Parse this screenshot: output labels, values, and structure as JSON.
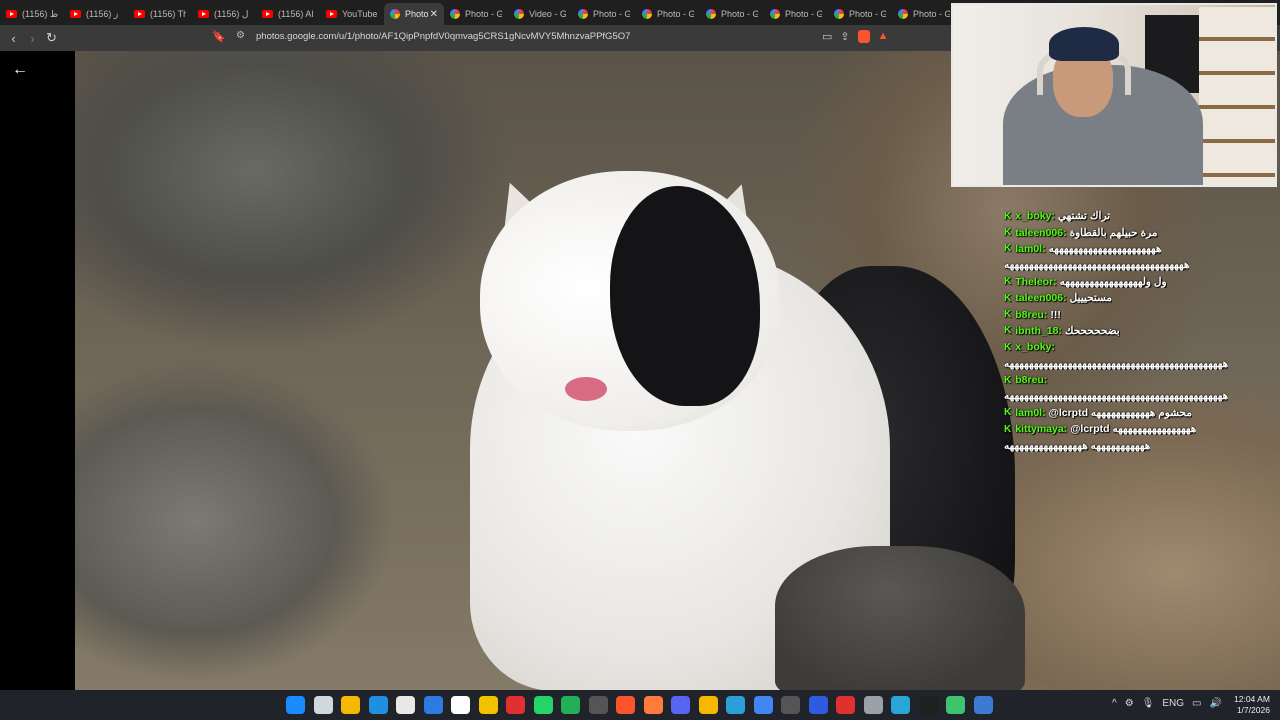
{
  "browser": {
    "tabs": [
      {
        "label": "(1156) ظ",
        "favicon": "youtube-icon"
      },
      {
        "label": "(1156) ز",
        "favicon": "youtube-icon"
      },
      {
        "label": "(1156) Th",
        "favicon": "youtube-icon"
      },
      {
        "label": "(1156) ل",
        "favicon": "youtube-icon"
      },
      {
        "label": "(1156) Al",
        "favicon": "youtube-icon"
      },
      {
        "label": "YouTube",
        "favicon": "youtube-icon"
      },
      {
        "label": "Photo",
        "favicon": "google-photos-icon",
        "active": true
      },
      {
        "label": "Photo - G",
        "favicon": "google-photos-icon"
      },
      {
        "label": "Video - G",
        "favicon": "google-photos-icon"
      },
      {
        "label": "Photo - G",
        "favicon": "google-photos-icon"
      },
      {
        "label": "Photo - G",
        "favicon": "google-photos-icon"
      },
      {
        "label": "Photo - G",
        "favicon": "google-photos-icon"
      },
      {
        "label": "Photo - G",
        "favicon": "google-photos-icon"
      },
      {
        "label": "Photo - G",
        "favicon": "google-photos-icon"
      },
      {
        "label": "Photo - G",
        "favicon": "google-photos-icon"
      }
    ],
    "close_glyph": "✕",
    "url": "photos.google.com/u/1/photo/AF1QipPnpfdV0qmvag5CRS1gNcvMVY5MhnzvaPPfG5O7",
    "brave_badge": "2"
  },
  "chat": {
    "messages": [
      {
        "user": "x_boky:",
        "text": "تراك تشتهي"
      },
      {
        "user": "taleen006:",
        "text": "مرة حبيلهم بالقطاوة"
      },
      {
        "user": "lam0l:",
        "text": "ههههههههههههههههههههههه"
      },
      {
        "user": "",
        "text": "هههههههههههههههههههههههههههههههههههههه"
      },
      {
        "user": "Theleor:",
        "text": "ول ولههههههههههههههههه"
      },
      {
        "user": "taleen006:",
        "text": "مستحيييل"
      },
      {
        "user": "b8reu:",
        "text": "!!!"
      },
      {
        "user": "ibnth_18:",
        "text": "بضحححححك"
      },
      {
        "user": "x_boky:",
        "text": ""
      },
      {
        "user": "",
        "text": "هههههههههههههههههههههههههههههههههههههههههههههه"
      },
      {
        "user": "b8reu:",
        "text": ""
      },
      {
        "user": "",
        "text": "هههههههههههههههههههههههههههههههههههههههههههههه"
      },
      {
        "user": "lam0l:",
        "text": "@lcrptd محشوم ههههههههههههه"
      },
      {
        "user": "kittymaya:",
        "text": "@lcrptd ههههههههههههههههه"
      },
      {
        "user": "",
        "text": "هههههههههههه ههههههههههههههههه"
      }
    ],
    "kick_glyph": "K"
  },
  "taskbar": {
    "icon_colors": [
      "#1a8cff",
      "#cfd8dc",
      "#f5b700",
      "#1f8fe0",
      "#e8e8e8",
      "#2d7be0",
      "#ffffff",
      "#f2c200",
      "#e03030",
      "#25d366",
      "#21b058",
      "#555555",
      "#fb542b",
      "#ff7a3d",
      "#5865f2",
      "#f5b700",
      "#2b9fd8",
      "#4285f4",
      "#555555",
      "#2f5be0",
      "#e03030",
      "#9aa0a6",
      "#2aa6d6",
      "#202020",
      "#3ec46d",
      "#3b7bd4"
    ],
    "language": "ENG",
    "time": "12:04 AM",
    "date": "1/7/2026"
  }
}
